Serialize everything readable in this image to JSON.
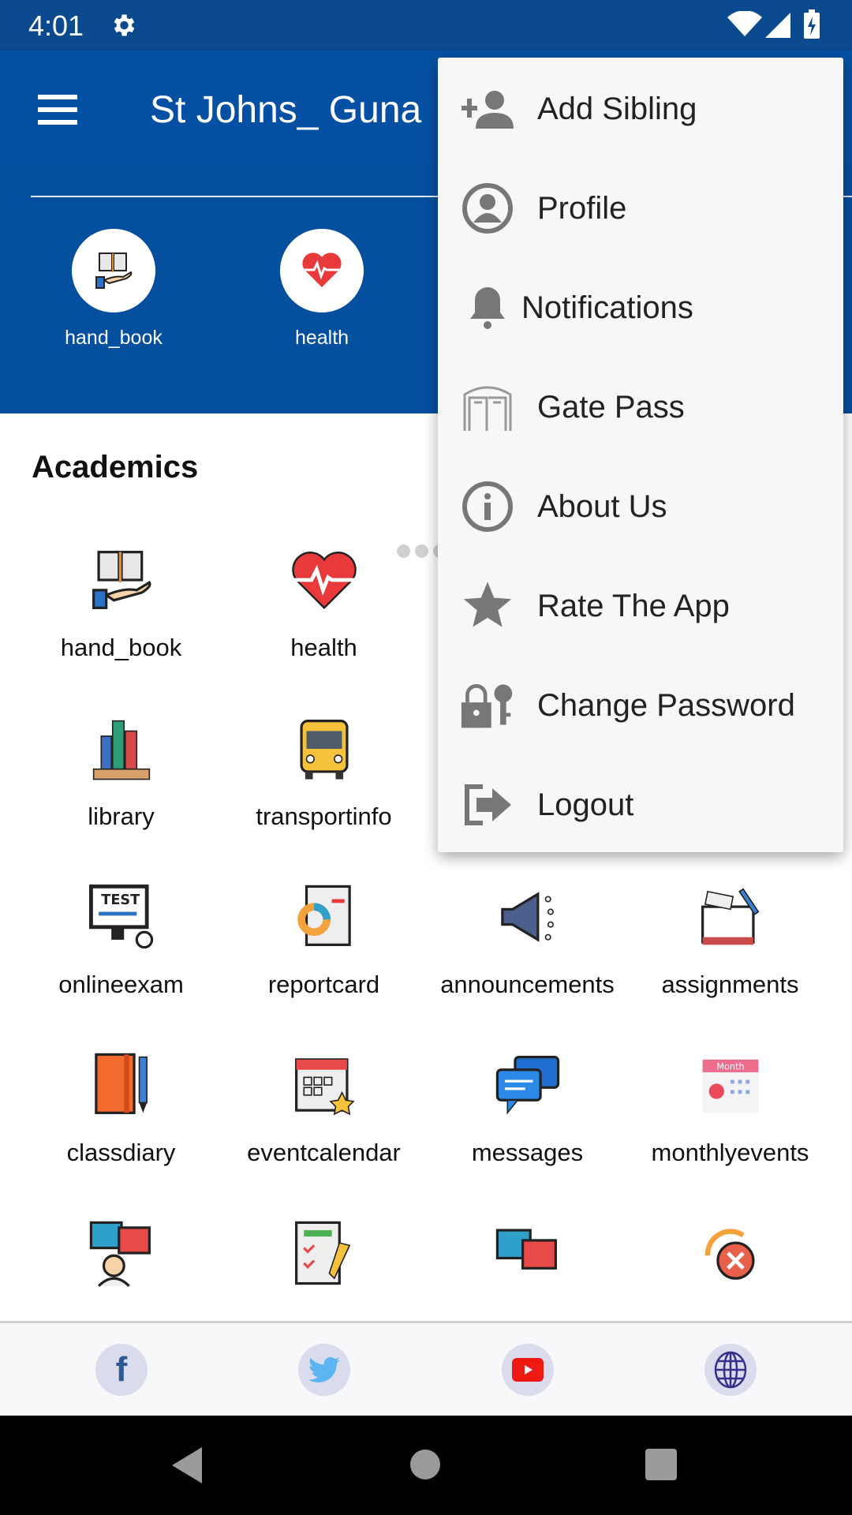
{
  "status_bar": {
    "time": "4:01",
    "icons": [
      "gear-icon",
      "wifi-icon",
      "signal-icon",
      "battery-charging-icon"
    ]
  },
  "app_bar": {
    "title": "St Johns_ Guna",
    "menu_icon": "hamburger-icon"
  },
  "banner": {
    "items": [
      {
        "label": "hand_book",
        "icon": "handbook-icon"
      },
      {
        "label": "health",
        "icon": "heart-icon"
      }
    ],
    "page_dots": 4,
    "active_dot": 0
  },
  "section": {
    "title": "Academics"
  },
  "grid": [
    {
      "label": "hand_book",
      "icon": "handbook-icon"
    },
    {
      "label": "health",
      "icon": "heart-icon"
    },
    {
      "label": "library",
      "icon": "library-icon"
    },
    {
      "label": "transportinfo",
      "icon": "bus-icon"
    },
    {
      "label": "onlineexam",
      "icon": "test-icon"
    },
    {
      "label": "reportcard",
      "icon": "report-icon"
    },
    {
      "label": "announcements",
      "icon": "megaphone-icon"
    },
    {
      "label": "assignments",
      "icon": "assignment-icon"
    },
    {
      "label": "classdiary",
      "icon": "diary-icon"
    },
    {
      "label": "eventcalendar",
      "icon": "calendar-icon"
    },
    {
      "label": "messages",
      "icon": "messages-icon"
    },
    {
      "label": "monthlyevents",
      "icon": "month-calendar-icon"
    }
  ],
  "month_icon_text": "Month",
  "overflow_menu": [
    {
      "label": "Add Sibling",
      "icon": "add-person-icon"
    },
    {
      "label": "Profile",
      "icon": "profile-icon"
    },
    {
      "label": "Notifications",
      "icon": "bell-icon"
    },
    {
      "label": "Gate Pass",
      "icon": "gate-icon"
    },
    {
      "label": "About Us",
      "icon": "info-icon"
    },
    {
      "label": "Rate The App",
      "icon": "star-icon"
    },
    {
      "label": "Change Password",
      "icon": "lock-key-icon"
    },
    {
      "label": "Logout",
      "icon": "logout-icon"
    }
  ],
  "footer": {
    "links": [
      "facebook-icon",
      "twitter-icon",
      "youtube-icon",
      "globe-icon"
    ]
  },
  "colors": {
    "primary": "#0650a4",
    "status_bar": "#0b4a8e",
    "menu_bg": "#f7f7f7"
  }
}
